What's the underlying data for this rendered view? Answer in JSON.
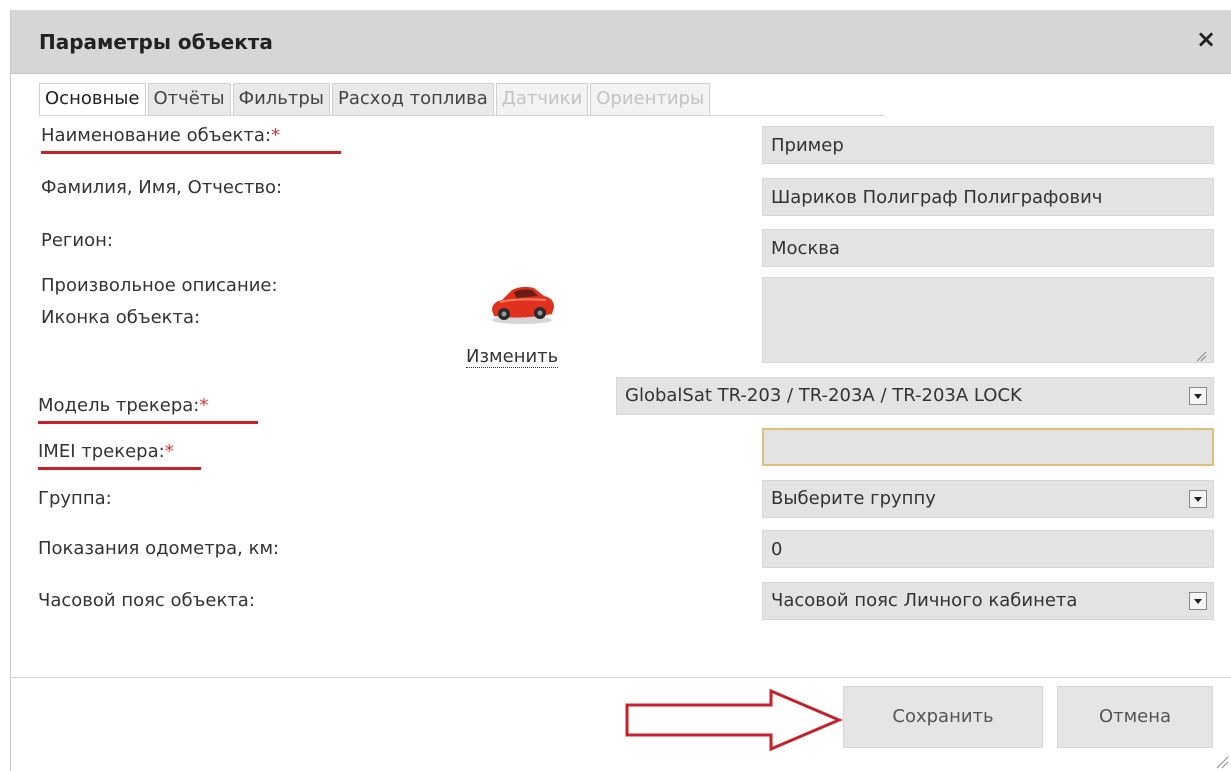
{
  "dialog": {
    "title": "Параметры объекта",
    "close_icon": "×"
  },
  "tabs": [
    {
      "label": "Основные",
      "state": "active"
    },
    {
      "label": "Отчёты",
      "state": "normal"
    },
    {
      "label": "Фильтры",
      "state": "normal"
    },
    {
      "label": "Расход топлива",
      "state": "normal"
    },
    {
      "label": "Датчики",
      "state": "disabled"
    },
    {
      "label": "Ориентиры",
      "state": "disabled"
    }
  ],
  "form": {
    "name_label": "Наименование объекта:",
    "name_value": "Пример",
    "fio_label": "Фамилия, Имя, Отчество:",
    "fio_value": "Шариков Полиграф Полиграфович",
    "region_label": "Регион:",
    "region_value": "Москва",
    "description_label": "Произвольное описание:",
    "description_value": "",
    "icon_label": "Иконка объекта:",
    "icon_name": "red-car-icon",
    "change_link": "Изменить",
    "tracker_model_label": "Модель трекера:",
    "tracker_model_value": "GlobalSat TR-203 / TR-203A / TR-203A LOCK",
    "imei_label": "IMEI трекера:",
    "imei_value": "",
    "group_label": "Группа:",
    "group_value": "Выберите группу",
    "odometer_label": "Показания одометра, км:",
    "odometer_value": "0",
    "timezone_label": "Часовой пояс объекта:",
    "timezone_value": "Часовой пояс Личного кабинета",
    "required_mark": "*"
  },
  "footer": {
    "save_label": "Сохранить",
    "cancel_label": "Отмена"
  },
  "colors": {
    "required": "#e53030",
    "underline": "#c8202a",
    "arrow": "#c8202a",
    "imei_border": "#e3c07a"
  }
}
